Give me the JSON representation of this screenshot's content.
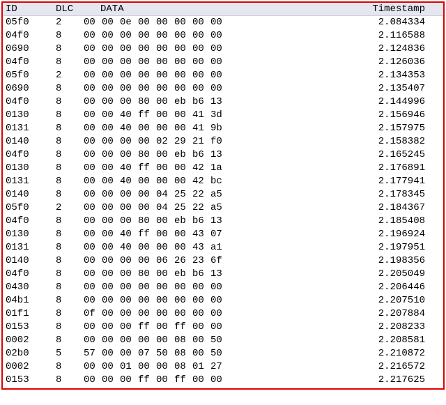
{
  "columns": {
    "id": "ID",
    "dlc": "DLC",
    "data": "DATA",
    "timestamp": "Timestamp"
  },
  "rows": [
    {
      "id": "05f0",
      "dlc": "2",
      "data": [
        "00",
        "00",
        "0e",
        "00",
        "00",
        "00",
        "00",
        "00"
      ],
      "ts": "2.084334"
    },
    {
      "id": "04f0",
      "dlc": "8",
      "data": [
        "00",
        "00",
        "00",
        "00",
        "00",
        "00",
        "00",
        "00"
      ],
      "ts": "2.116588"
    },
    {
      "id": "0690",
      "dlc": "8",
      "data": [
        "00",
        "00",
        "00",
        "00",
        "00",
        "00",
        "00",
        "00"
      ],
      "ts": "2.124836"
    },
    {
      "id": "04f0",
      "dlc": "8",
      "data": [
        "00",
        "00",
        "00",
        "00",
        "00",
        "00",
        "00",
        "00"
      ],
      "ts": "2.126036"
    },
    {
      "id": "05f0",
      "dlc": "2",
      "data": [
        "00",
        "00",
        "00",
        "00",
        "00",
        "00",
        "00",
        "00"
      ],
      "ts": "2.134353"
    },
    {
      "id": "0690",
      "dlc": "8",
      "data": [
        "00",
        "00",
        "00",
        "00",
        "00",
        "00",
        "00",
        "00"
      ],
      "ts": "2.135407"
    },
    {
      "id": "04f0",
      "dlc": "8",
      "data": [
        "00",
        "00",
        "00",
        "80",
        "00",
        "eb",
        "b6",
        "13"
      ],
      "ts": "2.144996"
    },
    {
      "id": "0130",
      "dlc": "8",
      "data": [
        "00",
        "00",
        "40",
        "ff",
        "00",
        "00",
        "41",
        "3d"
      ],
      "ts": "2.156946"
    },
    {
      "id": "0131",
      "dlc": "8",
      "data": [
        "00",
        "00",
        "40",
        "00",
        "00",
        "00",
        "41",
        "9b"
      ],
      "ts": "2.157975"
    },
    {
      "id": "0140",
      "dlc": "8",
      "data": [
        "00",
        "00",
        "00",
        "00",
        "02",
        "29",
        "21",
        "f0"
      ],
      "ts": "2.158382"
    },
    {
      "id": "04f0",
      "dlc": "8",
      "data": [
        "00",
        "00",
        "00",
        "80",
        "00",
        "eb",
        "b6",
        "13"
      ],
      "ts": "2.165245"
    },
    {
      "id": "0130",
      "dlc": "8",
      "data": [
        "00",
        "00",
        "40",
        "ff",
        "00",
        "00",
        "42",
        "1a"
      ],
      "ts": "2.176891"
    },
    {
      "id": "0131",
      "dlc": "8",
      "data": [
        "00",
        "00",
        "40",
        "00",
        "00",
        "00",
        "42",
        "bc"
      ],
      "ts": "2.177941"
    },
    {
      "id": "0140",
      "dlc": "8",
      "data": [
        "00",
        "00",
        "00",
        "00",
        "04",
        "25",
        "22",
        "a5"
      ],
      "ts": "2.178345"
    },
    {
      "id": "05f0",
      "dlc": "2",
      "data": [
        "00",
        "00",
        "00",
        "00",
        "04",
        "25",
        "22",
        "a5"
      ],
      "ts": "2.184367"
    },
    {
      "id": "04f0",
      "dlc": "8",
      "data": [
        "00",
        "00",
        "00",
        "80",
        "00",
        "eb",
        "b6",
        "13"
      ],
      "ts": "2.185408"
    },
    {
      "id": "0130",
      "dlc": "8",
      "data": [
        "00",
        "00",
        "40",
        "ff",
        "00",
        "00",
        "43",
        "07"
      ],
      "ts": "2.196924"
    },
    {
      "id": "0131",
      "dlc": "8",
      "data": [
        "00",
        "00",
        "40",
        "00",
        "00",
        "00",
        "43",
        "a1"
      ],
      "ts": "2.197951"
    },
    {
      "id": "0140",
      "dlc": "8",
      "data": [
        "00",
        "00",
        "00",
        "00",
        "06",
        "26",
        "23",
        "6f"
      ],
      "ts": "2.198356"
    },
    {
      "id": "04f0",
      "dlc": "8",
      "data": [
        "00",
        "00",
        "00",
        "80",
        "00",
        "eb",
        "b6",
        "13"
      ],
      "ts": "2.205049"
    },
    {
      "id": "0430",
      "dlc": "8",
      "data": [
        "00",
        "00",
        "00",
        "00",
        "00",
        "00",
        "00",
        "00"
      ],
      "ts": "2.206446"
    },
    {
      "id": "04b1",
      "dlc": "8",
      "data": [
        "00",
        "00",
        "00",
        "00",
        "00",
        "00",
        "00",
        "00"
      ],
      "ts": "2.207510"
    },
    {
      "id": "01f1",
      "dlc": "8",
      "data": [
        "0f",
        "00",
        "00",
        "00",
        "00",
        "00",
        "00",
        "00"
      ],
      "ts": "2.207884"
    },
    {
      "id": "0153",
      "dlc": "8",
      "data": [
        "00",
        "00",
        "00",
        "ff",
        "00",
        "ff",
        "00",
        "00"
      ],
      "ts": "2.208233"
    },
    {
      "id": "0002",
      "dlc": "8",
      "data": [
        "00",
        "00",
        "00",
        "00",
        "00",
        "08",
        "00",
        "50"
      ],
      "ts": "2.208581"
    },
    {
      "id": "02b0",
      "dlc": "5",
      "data": [
        "57",
        "00",
        "00",
        "07",
        "50",
        "08",
        "00",
        "50"
      ],
      "ts": "2.210872"
    },
    {
      "id": "0002",
      "dlc": "8",
      "data": [
        "00",
        "00",
        "01",
        "00",
        "00",
        "08",
        "01",
        "27"
      ],
      "ts": "2.216572"
    },
    {
      "id": "0153",
      "dlc": "8",
      "data": [
        "00",
        "00",
        "00",
        "ff",
        "00",
        "ff",
        "00",
        "00"
      ],
      "ts": "2.217625"
    }
  ]
}
